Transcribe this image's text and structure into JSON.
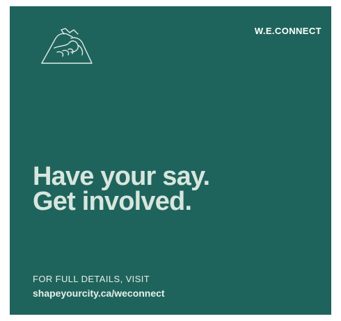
{
  "brand": {
    "name": "W.E.CONNECT",
    "icon": "handshake-icon"
  },
  "headline": {
    "line1": "Have your say.",
    "line2": "Get involved."
  },
  "footer": {
    "label": "FOR FULL DETAILS, VISIT",
    "url": "shapeyourcity.ca/weconnect"
  },
  "colors": {
    "background": "#1f645c",
    "text": "#e1ebe6"
  }
}
